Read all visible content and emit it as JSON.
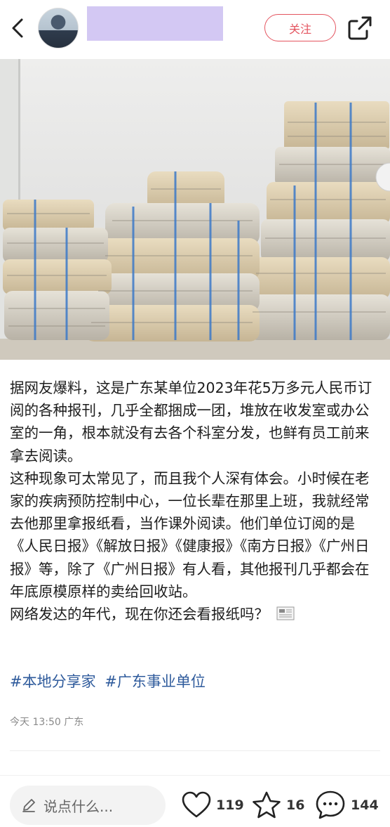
{
  "header": {
    "follow_label": "关注",
    "back_icon": "back-arrow-icon",
    "share_icon": "share-icon"
  },
  "post": {
    "paragraphs": [
      "据网友爆料，这是广东某单位2023年花5万多元人民币订阅的各种报刊，几乎全都捆成一团，堆放在收发室或办公室的一角，根本就没有去各个科室分发，也鲜有员工前来拿去阅读。",
      "这种现象可太常见了，而且我个人深有体会。小时候在老家的疾病预防控制中心，一位长辈在那里上班，我就经常去他那里拿报纸看，当作课外阅读。他们单位订阅的是《人民日报》《解放日报》《健康报》《南方日报》《广州日报》等，除了《广州日报》有人看，其他报刊几乎都会在年底原模原样的卖给回收站。",
      "网络发达的年代，现在你还会看报纸吗？"
    ],
    "tags": [
      "#本地分享家",
      "#广东事业单位"
    ],
    "meta": "今天 13:50 广东"
  },
  "bottom": {
    "comment_placeholder": "说点什么...",
    "like_count": "119",
    "favorite_count": "16",
    "comment_count": "144"
  }
}
